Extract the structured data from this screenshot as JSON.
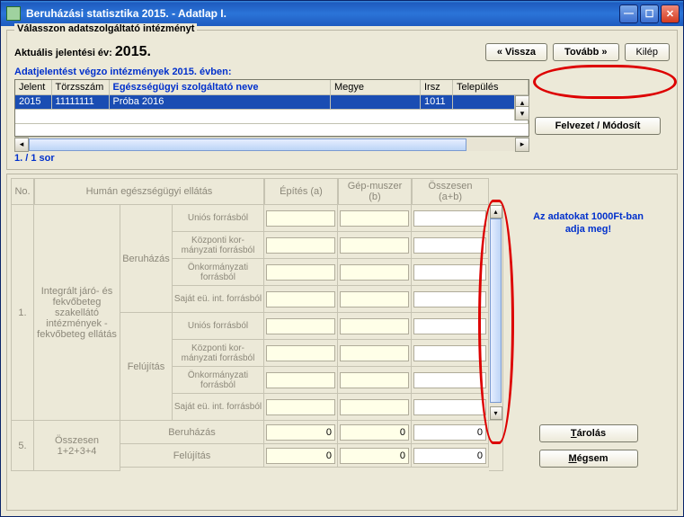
{
  "window": {
    "title": "Beruházási statisztika 2015. - Adatlap I."
  },
  "top": {
    "legend": "Válasszon adatszolgáltató intézményt",
    "year_label": "Aktuális jelentési év: ",
    "year_value": "2015.",
    "back": "« Vissza",
    "next": "Tovább »",
    "exit": "Kilép",
    "grid_title": "Adatjelentést végzo intézmények  2015. évben:",
    "headers": {
      "jelent": "Jelent",
      "torzs": "Törzsszám",
      "nev": "Egészségügyi szolgáltató neve",
      "megye": "Megye",
      "irsz": "Irsz",
      "telep": "Település"
    },
    "row": {
      "jelent": "2015",
      "torzs": "11111111",
      "nev": "Próba 2016",
      "megye": "",
      "irsz": "1011",
      "telep": ""
    },
    "count": "1. / 1 sor",
    "edit_btn": "Felvezet / Módosít"
  },
  "form": {
    "headers": {
      "no": "No.",
      "human": "Humán egészségügyi ellátás",
      "a": "Építés (a)",
      "b": "Gép-muszer (b)",
      "sum": "Összesen (a+b)"
    },
    "hint_line1": "Az adatokat 1000Ft-ban",
    "hint_line2": "adja meg!",
    "section1": {
      "no": "1.",
      "desc": "Integrált járó- és fekvőbeteg szakellátó intézmények - fekvőbeteg ellátás",
      "phases": [
        "Beruházás",
        "Felújítás"
      ],
      "sources": [
        "Uniós forrásból",
        "Központi kor-\nmányzati forrásból",
        "Önkormányzati forrásból",
        "Saját eü. int. forrásból"
      ]
    },
    "totals": {
      "no": "5.",
      "desc": "Összesen 1+2+3+4",
      "rows": [
        "Beruházás",
        "Felújítás"
      ],
      "values": {
        "ber_a": "0",
        "ber_b": "0",
        "ber_sum": "0",
        "fel_a": "0",
        "fel_b": "0",
        "fel_sum": "0"
      }
    },
    "save": "Tárolás",
    "cancel": "Mégsem",
    "save_u": "T",
    "cancel_u": "M"
  }
}
